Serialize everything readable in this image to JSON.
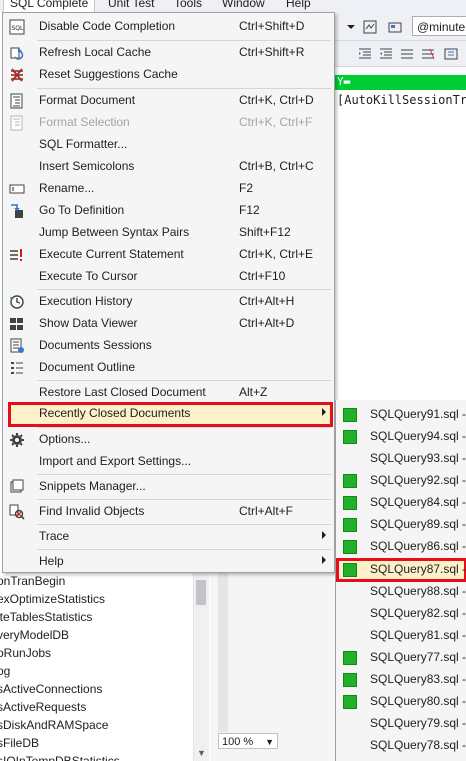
{
  "menubar": {
    "items": [
      "SQL Complete",
      "Unit Test",
      "Tools",
      "Window",
      "Help"
    ]
  },
  "toolbar": {
    "db_selector_value": "@minute"
  },
  "editor": {
    "code_line": "[AutoKillSessionTra"
  },
  "menu": {
    "items": [
      {
        "label": "Disable Code Completion",
        "shortcut": "Ctrl+Shift+D",
        "icon": "sql-icon"
      },
      {
        "label": "Refresh Local Cache",
        "shortcut": "Ctrl+Shift+R",
        "icon": "refresh-icon"
      },
      {
        "label": "Reset Suggestions Cache",
        "shortcut": "",
        "icon": "reset-cache-icon"
      },
      {
        "label": "Format Document",
        "shortcut": "Ctrl+K, Ctrl+D",
        "icon": "format-document-icon"
      },
      {
        "label": "Format Selection",
        "shortcut": "Ctrl+K, Ctrl+F",
        "icon": "format-selection-icon"
      },
      {
        "label": "SQL Formatter...",
        "shortcut": "",
        "icon": ""
      },
      {
        "label": "Insert Semicolons",
        "shortcut": "Ctrl+B, Ctrl+C",
        "icon": ""
      },
      {
        "label": "Rename...",
        "shortcut": "F2",
        "icon": "rename-icon"
      },
      {
        "label": "Go To Definition",
        "shortcut": "F12",
        "icon": "go-to-definition-icon"
      },
      {
        "label": "Jump Between Syntax Pairs",
        "shortcut": "Shift+F12",
        "icon": ""
      },
      {
        "label": "Execute Current Statement",
        "shortcut": "Ctrl+K, Ctrl+E",
        "icon": "execute-statement-icon"
      },
      {
        "label": "Execute To Cursor",
        "shortcut": "Ctrl+F10",
        "icon": ""
      },
      {
        "label": "Execution History",
        "shortcut": "Ctrl+Alt+H",
        "icon": "history-icon"
      },
      {
        "label": "Show Data Viewer",
        "shortcut": "Ctrl+Alt+D",
        "icon": "data-viewer-icon"
      },
      {
        "label": "Documents Sessions",
        "shortcut": "",
        "icon": "documents-sessions-icon"
      },
      {
        "label": "Document Outline",
        "shortcut": "",
        "icon": "document-outline-icon"
      },
      {
        "label": "Restore Last Closed Document",
        "shortcut": "Alt+Z",
        "icon": ""
      },
      {
        "label": "Recently Closed Documents",
        "shortcut": "",
        "icon": ""
      },
      {
        "label": "Options...",
        "shortcut": "",
        "icon": "gear-icon"
      },
      {
        "label": "Import and Export Settings...",
        "shortcut": "",
        "icon": ""
      },
      {
        "label": "Snippets Manager...",
        "shortcut": "",
        "icon": "snippets-icon"
      },
      {
        "label": "Find Invalid Objects",
        "shortcut": "Ctrl+Alt+F",
        "icon": "find-invalid-icon"
      },
      {
        "label": "Trace",
        "shortcut": "",
        "icon": ""
      },
      {
        "label": "Help",
        "shortcut": "",
        "icon": ""
      }
    ]
  },
  "submenu": {
    "items": [
      {
        "label": "SQLQuery91.sql - ",
        "has_icon": true
      },
      {
        "label": "SQLQuery94.sql - ",
        "has_icon": true
      },
      {
        "label": "SQLQuery93.sql - ",
        "has_icon": false
      },
      {
        "label": "SQLQuery92.sql - ",
        "has_icon": true
      },
      {
        "label": "SQLQuery84.sql - ",
        "has_icon": true
      },
      {
        "label": "SQLQuery89.sql - ",
        "has_icon": true
      },
      {
        "label": "SQLQuery86.sql - ",
        "has_icon": true
      },
      {
        "label": "SQLQuery87.sql - ",
        "has_icon": true
      },
      {
        "label": "SQLQuery88.sql - ",
        "has_icon": false
      },
      {
        "label": "SQLQuery82.sql - ",
        "has_icon": false
      },
      {
        "label": "SQLQuery81.sql - ",
        "has_icon": false
      },
      {
        "label": "SQLQuery77.sql - ",
        "has_icon": true
      },
      {
        "label": "SQLQuery83.sql - ",
        "has_icon": true
      },
      {
        "label": "SQLQuery80.sql - ",
        "has_icon": true
      },
      {
        "label": "SQLQuery79.sql - ",
        "has_icon": false
      },
      {
        "label": "SQLQuery78.sql - ",
        "has_icon": false
      }
    ]
  },
  "object_list": {
    "rows": [
      "onTranBegin",
      "exOptimizeStatistics",
      "iteTablesStatistics",
      "veryModelDB",
      "oRunJobs",
      "og",
      "sActiveConnections",
      "sActiveRequests",
      "sDiskAndRAMSpace",
      "sFileDB",
      "sIOInTempDBStatistics"
    ]
  },
  "status": {
    "zoom": "100 %"
  },
  "colors": {
    "highlight_border": "#e30f1d",
    "highlight_fill": "#fcf1c9",
    "file_icon_green": "#22b02b",
    "editor_green": "#00cc33"
  }
}
